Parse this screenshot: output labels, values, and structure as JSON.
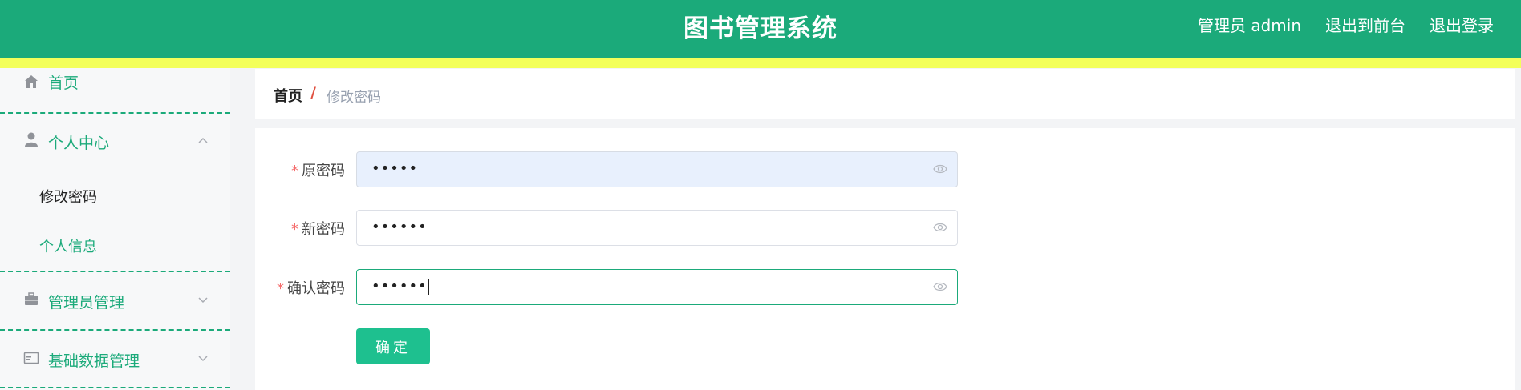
{
  "header": {
    "title": "图书管理系统",
    "user_label": "管理员 admin",
    "front_label": "退出到前台",
    "logout_label": "退出登录"
  },
  "sidebar": {
    "home": "首页",
    "personal_center": "个人中心",
    "change_password": "修改密码",
    "personal_info": "个人信息",
    "admin_management": "管理员管理",
    "base_data_management": "基础数据管理"
  },
  "breadcrumb": {
    "home": "首页",
    "separator": "/",
    "current": "修改密码"
  },
  "form": {
    "old_password_label": "原密码",
    "old_password_value": "•••••",
    "new_password_label": "新密码",
    "new_password_value": "••••••",
    "confirm_password_label": "确认密码",
    "confirm_password_value": "••••••",
    "required_mark": "*",
    "submit_label": "确定"
  },
  "colors": {
    "primary": "#1baa7a",
    "accent_bar": "#f3ff5a",
    "button": "#1ec08f",
    "required": "#f56c6c"
  }
}
